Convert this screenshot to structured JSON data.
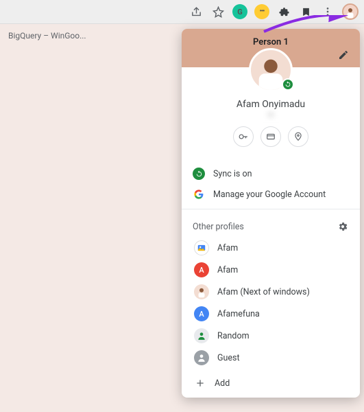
{
  "toolbar": {
    "share_icon": "share-icon",
    "star_icon": "star-icon",
    "grammarly_label": "G",
    "yellow_ext_label": "•••"
  },
  "tab": {
    "title": "BigQuery – WinGoo..."
  },
  "panel": {
    "profile_label": "Person 1",
    "display_name": "Afam Onyimadu",
    "email_masked": "m",
    "sync_label": "Sync is on",
    "manage_label": "Manage your Google Account",
    "other_profiles_label": "Other profiles",
    "add_label": "Add",
    "profiles": [
      {
        "name": "Afam",
        "color": "#ffffff",
        "initial": "",
        "icon": "picture"
      },
      {
        "name": "Afam",
        "color": "#ea4335",
        "initial": "A"
      },
      {
        "name": "Afam (Next of windows)",
        "color": "#f3ddd2",
        "initial": "",
        "icon": "face"
      },
      {
        "name": "Afamefuna",
        "color": "#4285f4",
        "initial": "A"
      },
      {
        "name": "Random",
        "color": "#e8eaed",
        "initial": "",
        "icon": "person-green"
      },
      {
        "name": "Guest",
        "color": "#9aa0a6",
        "initial": "",
        "icon": "person-white"
      }
    ]
  }
}
